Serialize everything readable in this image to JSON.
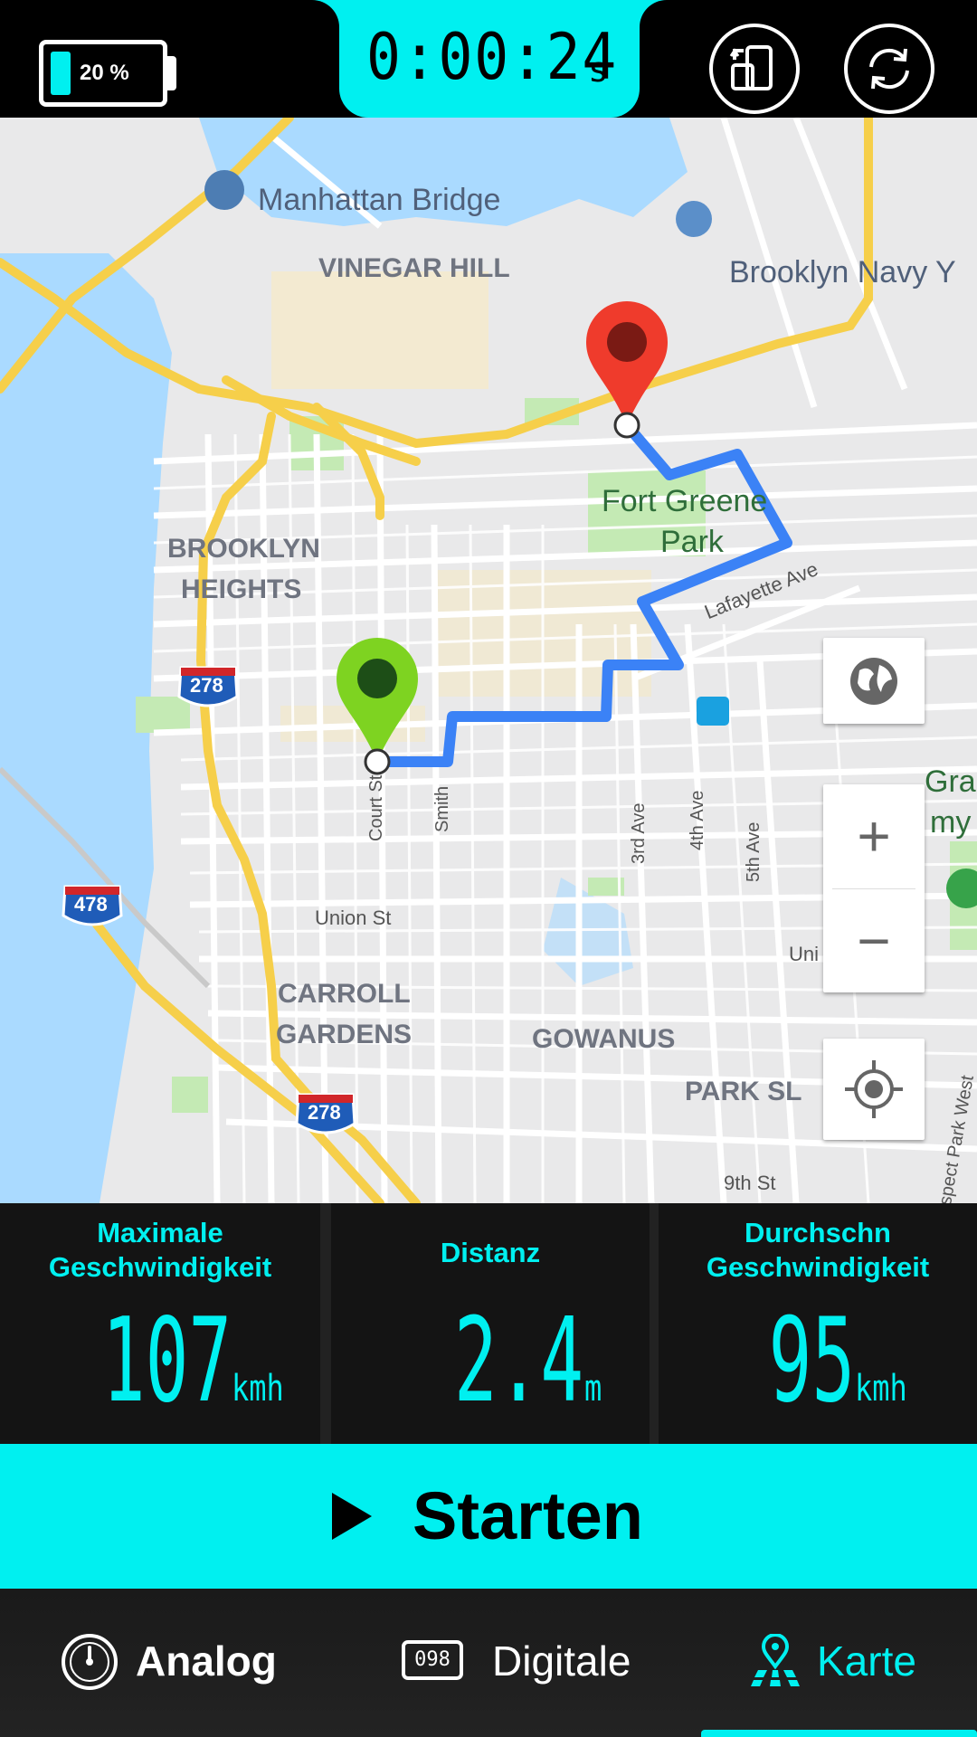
{
  "status": {
    "battery_percent": "20 %",
    "battery_level": 0.2
  },
  "timer": {
    "value": "0:00:24",
    "unit": "s"
  },
  "top_buttons": {
    "rotate": "rotate-screen-icon",
    "reset": "refresh-icon"
  },
  "map": {
    "labels": {
      "manhattan_bridge": "Manhattan Bridge",
      "vinegar_hill": "VINEGAR HILL",
      "brooklyn_navy": "Brooklyn Navy Y",
      "fort_greene_1": "Fort Greene",
      "fort_greene_2": "Park",
      "brooklyn_heights_1": "BROOKLYN",
      "brooklyn_heights_2": "HEIGHTS",
      "lafayette": "Lafayette Ave",
      "court_st": "Court St",
      "smith": "Smith",
      "third_ave": "3rd Ave",
      "fourth_ave": "4th Ave",
      "fifth_ave": "5th Ave",
      "union_st": "Union St",
      "union_right": "Uni",
      "carroll_1": "CARROLL",
      "carroll_2": "GARDENS",
      "gowanus": "GOWANUS",
      "park_slope": "PARK SL",
      "ninth_st": "9th St",
      "prospect_park_west": "spect Park West",
      "gra": "Gra",
      "my": "my",
      "hw_278_a": "278",
      "hw_278_b": "278",
      "hw_478": "478"
    },
    "controls": {
      "layers": "globe-icon",
      "zoom_in": "+",
      "zoom_out": "−",
      "locate": "locate-icon"
    }
  },
  "stats": {
    "max_speed": {
      "title_1": "Maximale",
      "title_2": "Geschwindigkeit",
      "value": "107",
      "unit": "kmh"
    },
    "distance": {
      "title": "Distanz",
      "value": "2.4",
      "unit": "m"
    },
    "avg_speed": {
      "title_1": "Durchschn",
      "title_2": "Geschwindigkeit",
      "value": "95",
      "unit": "kmh"
    }
  },
  "start_button": {
    "label": "Starten"
  },
  "nav": {
    "analog": "Analog",
    "digital": "Digitale",
    "digital_icon_text": "098",
    "map": "Karte",
    "active": "map"
  },
  "colors": {
    "accent": "#00f0f0",
    "route": "#3b82f6",
    "start_pin": "#7ed321",
    "end_pin": "#ef3b2c"
  }
}
